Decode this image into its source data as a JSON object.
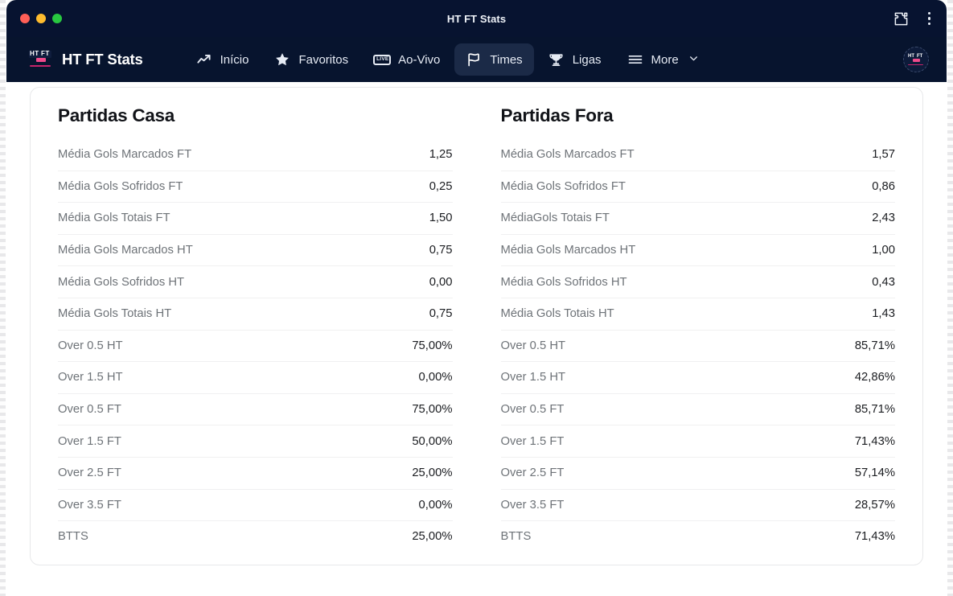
{
  "window": {
    "title": "HT FT Stats",
    "traffic_lights": [
      "close",
      "minimize",
      "maximize"
    ],
    "puzzle_icon": "puzzle-extension-icon",
    "menu_icon": "kebab-menu-icon"
  },
  "nav": {
    "brand": "HT FT Stats",
    "brand_logo": "htft-logo-icon",
    "items": [
      {
        "label": "Início",
        "icon": "trending-up-icon",
        "active": false
      },
      {
        "label": "Favoritos",
        "icon": "star-icon",
        "active": false
      },
      {
        "label": "Ao-Vivo",
        "icon": "live-badge-icon",
        "active": false
      },
      {
        "label": "Times",
        "icon": "flag-icon",
        "active": true
      },
      {
        "label": "Ligas",
        "icon": "trophy-icon",
        "active": false
      },
      {
        "label": "More",
        "icon": "hamburger-icon",
        "active": false,
        "chevron": "chevron-down-icon"
      }
    ],
    "avatar": "user-avatar-htft"
  },
  "panels": [
    {
      "title": "Partidas Casa",
      "rows": [
        {
          "label": "Média Gols Marcados FT",
          "value": "1,25"
        },
        {
          "label": "Média Gols Sofridos FT",
          "value": "0,25"
        },
        {
          "label": "Média Gols Totais FT",
          "value": "1,50"
        },
        {
          "label": "Média Gols Marcados HT",
          "value": "0,75"
        },
        {
          "label": "Média Gols Sofridos HT",
          "value": "0,00"
        },
        {
          "label": "Média Gols Totais HT",
          "value": "0,75"
        },
        {
          "label": "Over 0.5 HT",
          "value": "75,00%"
        },
        {
          "label": "Over 1.5 HT",
          "value": "0,00%"
        },
        {
          "label": "Over 0.5 FT",
          "value": "75,00%"
        },
        {
          "label": "Over 1.5 FT",
          "value": "50,00%"
        },
        {
          "label": "Over 2.5 FT",
          "value": "25,00%"
        },
        {
          "label": "Over 3.5 FT",
          "value": "0,00%"
        },
        {
          "label": "BTTS",
          "value": "25,00%"
        }
      ]
    },
    {
      "title": "Partidas Fora",
      "rows": [
        {
          "label": "Média Gols Marcados FT",
          "value": "1,57"
        },
        {
          "label": "Média Gols Sofridos FT",
          "value": "0,86"
        },
        {
          "label": "MédiaGols Totais FT",
          "value": "2,43"
        },
        {
          "label": "Média Gols Marcados HT",
          "value": "1,00"
        },
        {
          "label": "Média Gols Sofridos HT",
          "value": "0,43"
        },
        {
          "label": "Média Gols Totais HT",
          "value": "1,43"
        },
        {
          "label": "Over 0.5 HT",
          "value": "85,71%"
        },
        {
          "label": "Over 1.5 HT",
          "value": "42,86%"
        },
        {
          "label": "Over 0.5 FT",
          "value": "85,71%"
        },
        {
          "label": "Over 1.5 FT",
          "value": "71,43%"
        },
        {
          "label": "Over 2.5 FT",
          "value": "57,14%"
        },
        {
          "label": "Over 3.5 FT",
          "value": "28,57%"
        },
        {
          "label": "BTTS",
          "value": "71,43%"
        }
      ]
    }
  ],
  "colors": {
    "titlebar": "#071330",
    "navbar": "#07142e",
    "nav_active": "#1b2a47",
    "brand_pink": "#ef4a8b",
    "brand_magenta": "#c4246b",
    "page_bg": "#ffffff",
    "card_border": "#e7e8ea",
    "row_divider": "#f0f0f1",
    "label_text": "#6e7378",
    "value_text": "#1b1d21"
  }
}
